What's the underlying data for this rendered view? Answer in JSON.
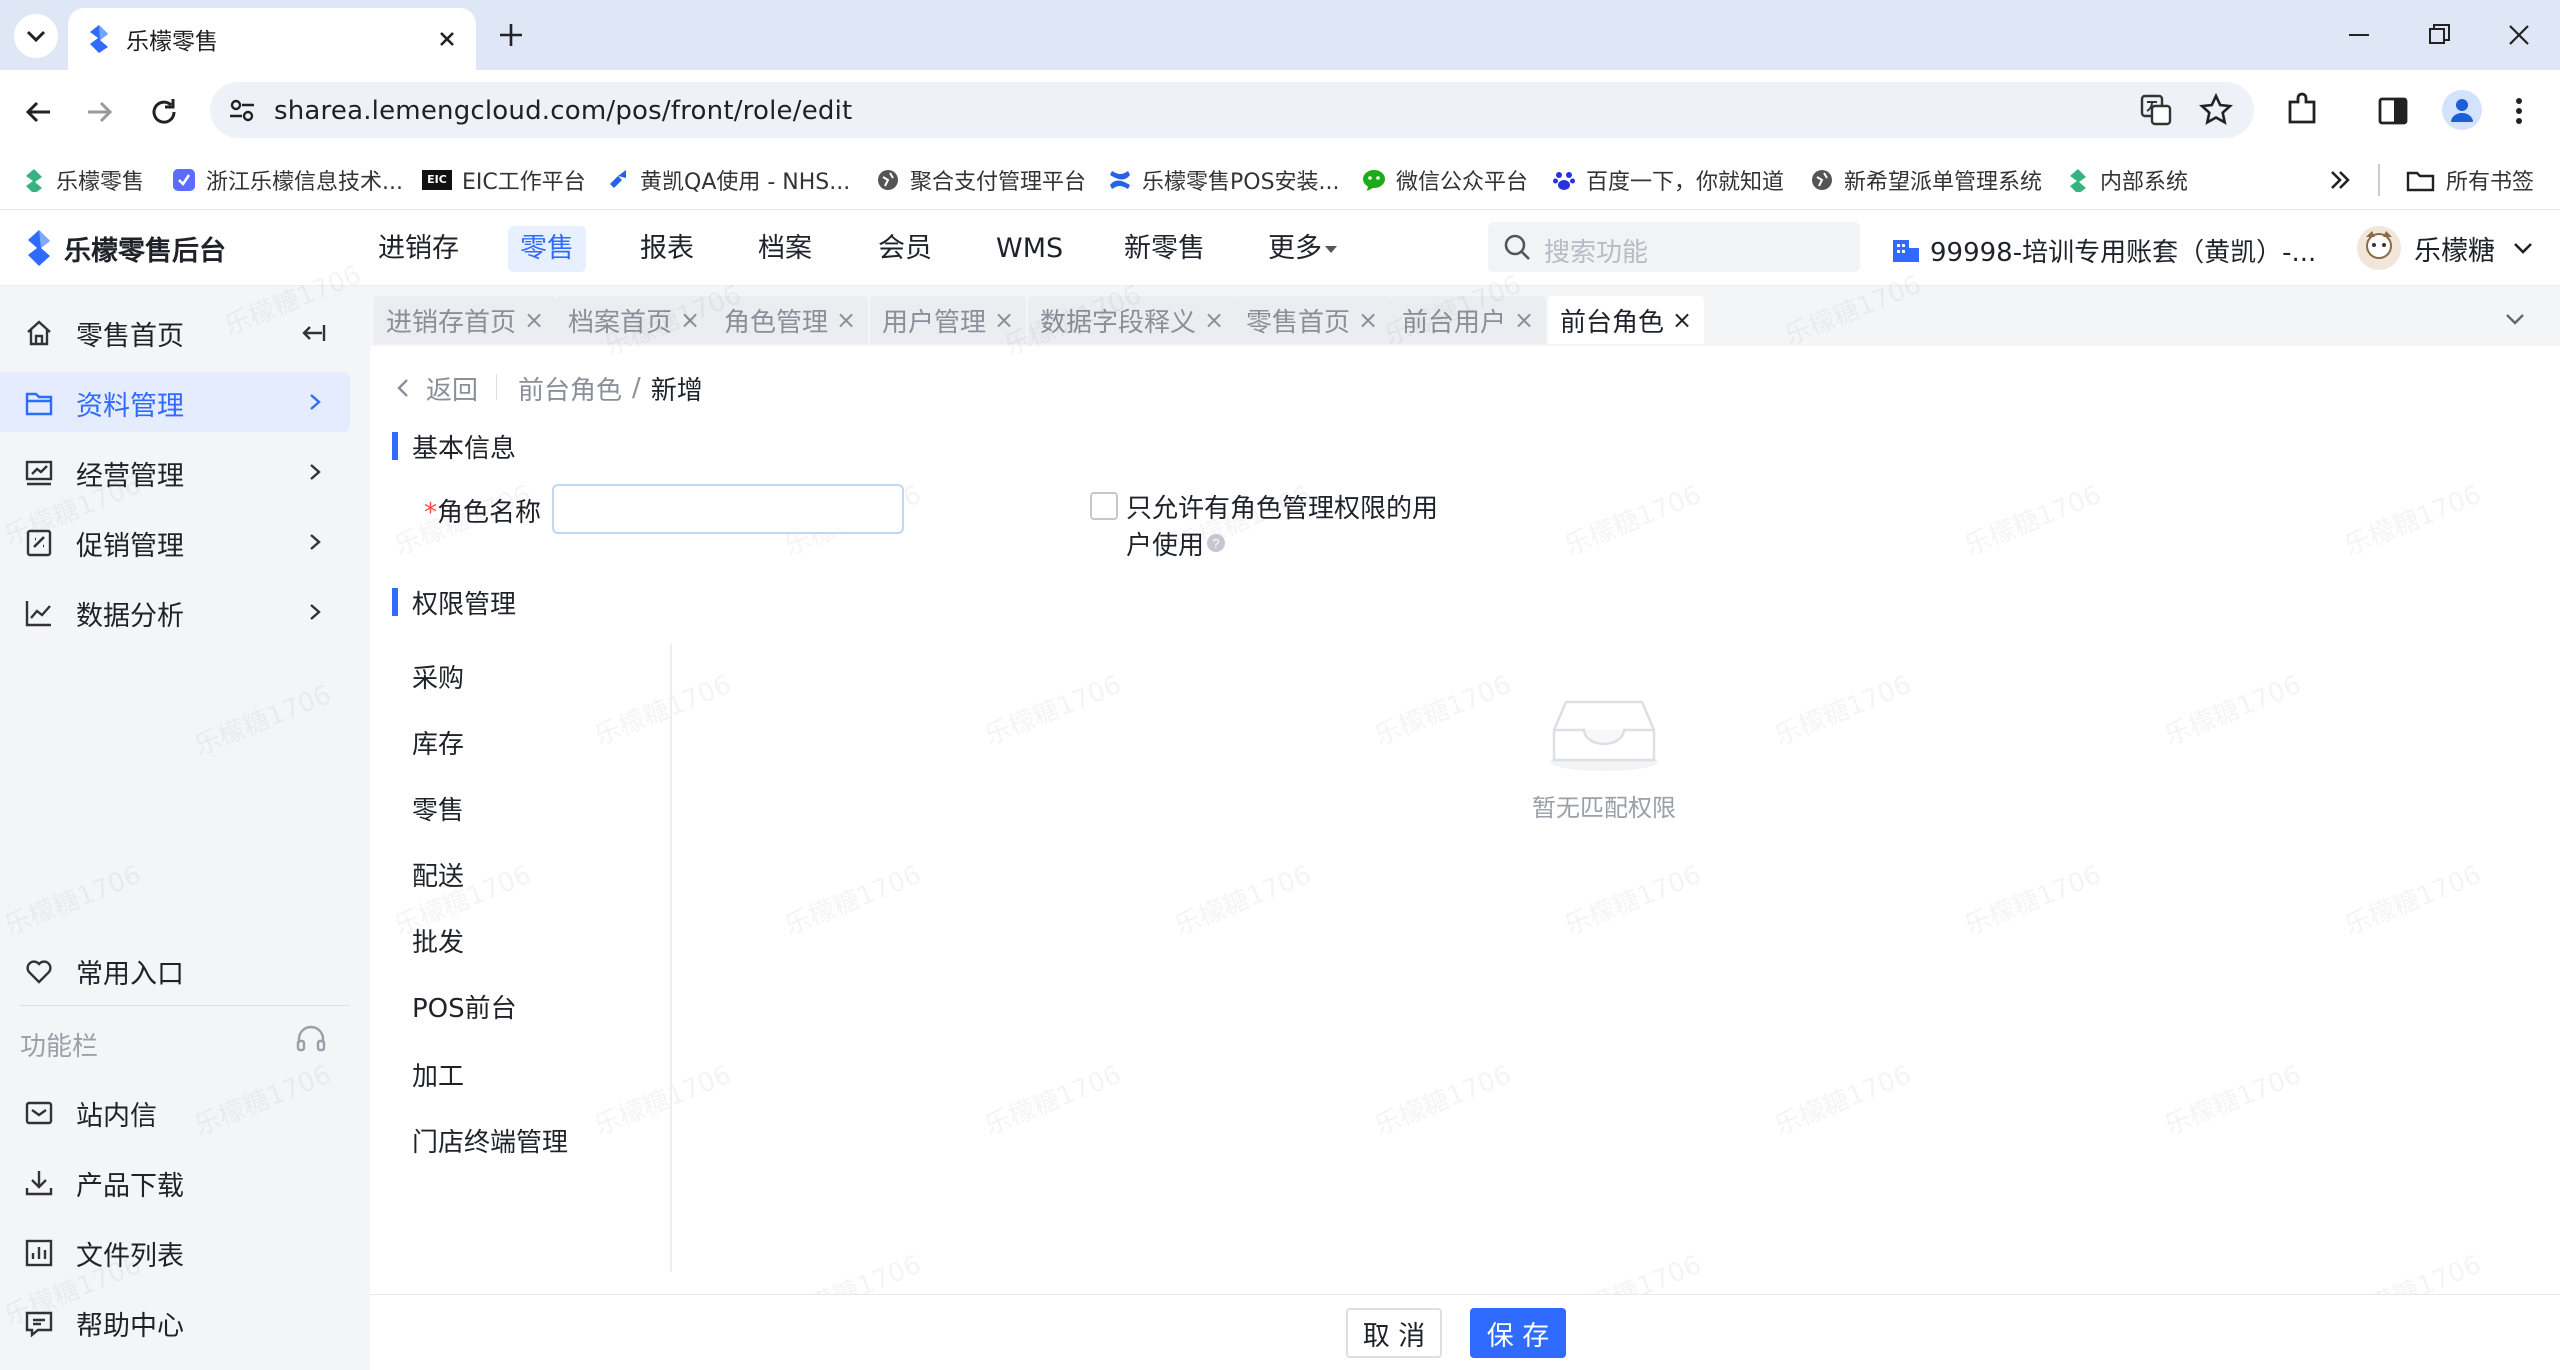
{
  "browser": {
    "tab_title": "乐檬零售",
    "url": "sharea.lemengcloud.com/pos/front/role/edit",
    "bookmarks": [
      "乐檬零售",
      "浙江乐檬信息技术...",
      "EIC工作平台",
      "黄凯QA使用 - NHS...",
      "聚合支付管理平台",
      "乐檬零售POS安装...",
      "微信公众平台",
      "百度一下，你就知道",
      "新希望派单管理系统",
      "内部系统"
    ],
    "all_bookmarks": "所有书签",
    "ext_badge": "EIC"
  },
  "app": {
    "logo": "乐檬零售后台",
    "nav": [
      "进销存",
      "零售",
      "报表",
      "档案",
      "会员",
      "WMS",
      "新零售",
      "更多"
    ],
    "active_nav": "零售",
    "search_placeholder": "搜索功能",
    "account": "99998-培训专用账套（黄凯）-...",
    "user": "乐檬糖"
  },
  "sidebar": {
    "items": [
      "零售首页",
      "资料管理",
      "经营管理",
      "促销管理",
      "数据分析"
    ],
    "active": "资料管理",
    "favorites": "常用入口",
    "func_label": "功能栏",
    "tools": [
      "站内信",
      "产品下载",
      "文件列表",
      "帮助中心"
    ]
  },
  "tabs": {
    "items": [
      "进销存首页",
      "档案首页",
      "角色管理",
      "用户管理",
      "数据字段释义",
      "零售首页",
      "前台用户",
      "前台角色"
    ],
    "active": "前台角色"
  },
  "page": {
    "back": "返回",
    "crumb_parent": "前台角色",
    "crumb_sep": "/",
    "crumb_current": "新增",
    "basic_info": "基本信息",
    "required_mark": "*",
    "role_name_label": "角色名称",
    "role_name_value": "",
    "checkbox_line1": "只允许有角色管理权限的用",
    "checkbox_line2": "户使用",
    "checkbox_checked": false,
    "perm_title": "权限管理",
    "perm_categories": [
      "采购",
      "库存",
      "零售",
      "配送",
      "批发",
      "POS前台",
      "加工",
      "门店终端管理"
    ],
    "empty_text": "暂无匹配权限",
    "watermark": "乐檬糖1706"
  },
  "footer": {
    "cancel": "取 消",
    "save": "保 存"
  },
  "colors": {
    "primary": "#2f6bff",
    "sidebar_bg": "#f4f5f7"
  }
}
